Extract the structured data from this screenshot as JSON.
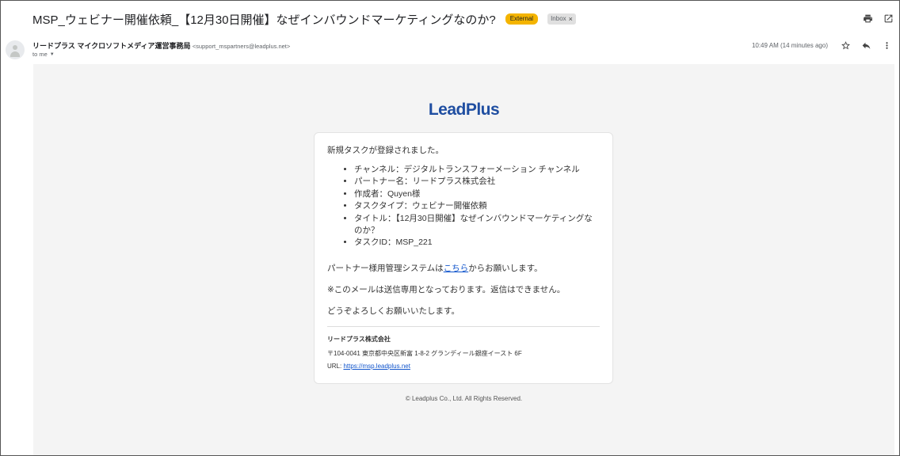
{
  "email": {
    "subject": "MSP_ウェビナー開催依頼_【12月30日開催】なぜインバウンドマーケティングなのか?",
    "labels": {
      "external": "External",
      "inbox": "Inbox",
      "remove": "×"
    },
    "sender_name": "リードプラス マイクロソフトメディア運営事務局",
    "sender_email": "<support_mspartners@leadplus.net>",
    "to": "to me",
    "time": "10:49 AM (14 minutes ago)"
  },
  "icons": {
    "print": "print-icon",
    "open_new": "open-in-new-icon",
    "star": "star-icon",
    "reply": "reply-icon",
    "more": "more-vert-icon"
  },
  "content": {
    "logo": "LeadPlus",
    "intro": "新規タスクが登録されました。",
    "items": [
      "チャンネル：デジタルトランスフォーメーション チャンネル",
      "パートナー名：リードプラス株式会社",
      "作成者：Quyen様",
      "タスクタイプ：ウェビナー開催依頼",
      "タイトル：【12月30日開催】なぜインバウンドマーケティングなのか？",
      "タスクID：MSP_221"
    ],
    "system_prefix": "パートナー様用管理システムは",
    "system_link": "こちら",
    "system_suffix": "からお願いします。",
    "notice": "※このメールは送信専用となっております。返信はできません。",
    "closing": "どうぞよろしくお願いいたします。",
    "footer": {
      "company": "リードプラス株式会社",
      "address": "〒104-0041 東京都中央区新富 1-8-2 グランディール銀座イースト 6F",
      "url_label": "URL: ",
      "url": "https://msp.leadplus.net"
    },
    "copyright": "© Leadplus Co., Ltd. All Rights Reserved."
  },
  "colors": {
    "external_badge": "#f4b400",
    "logo": "#1f4ea1",
    "link": "#1155cc"
  }
}
